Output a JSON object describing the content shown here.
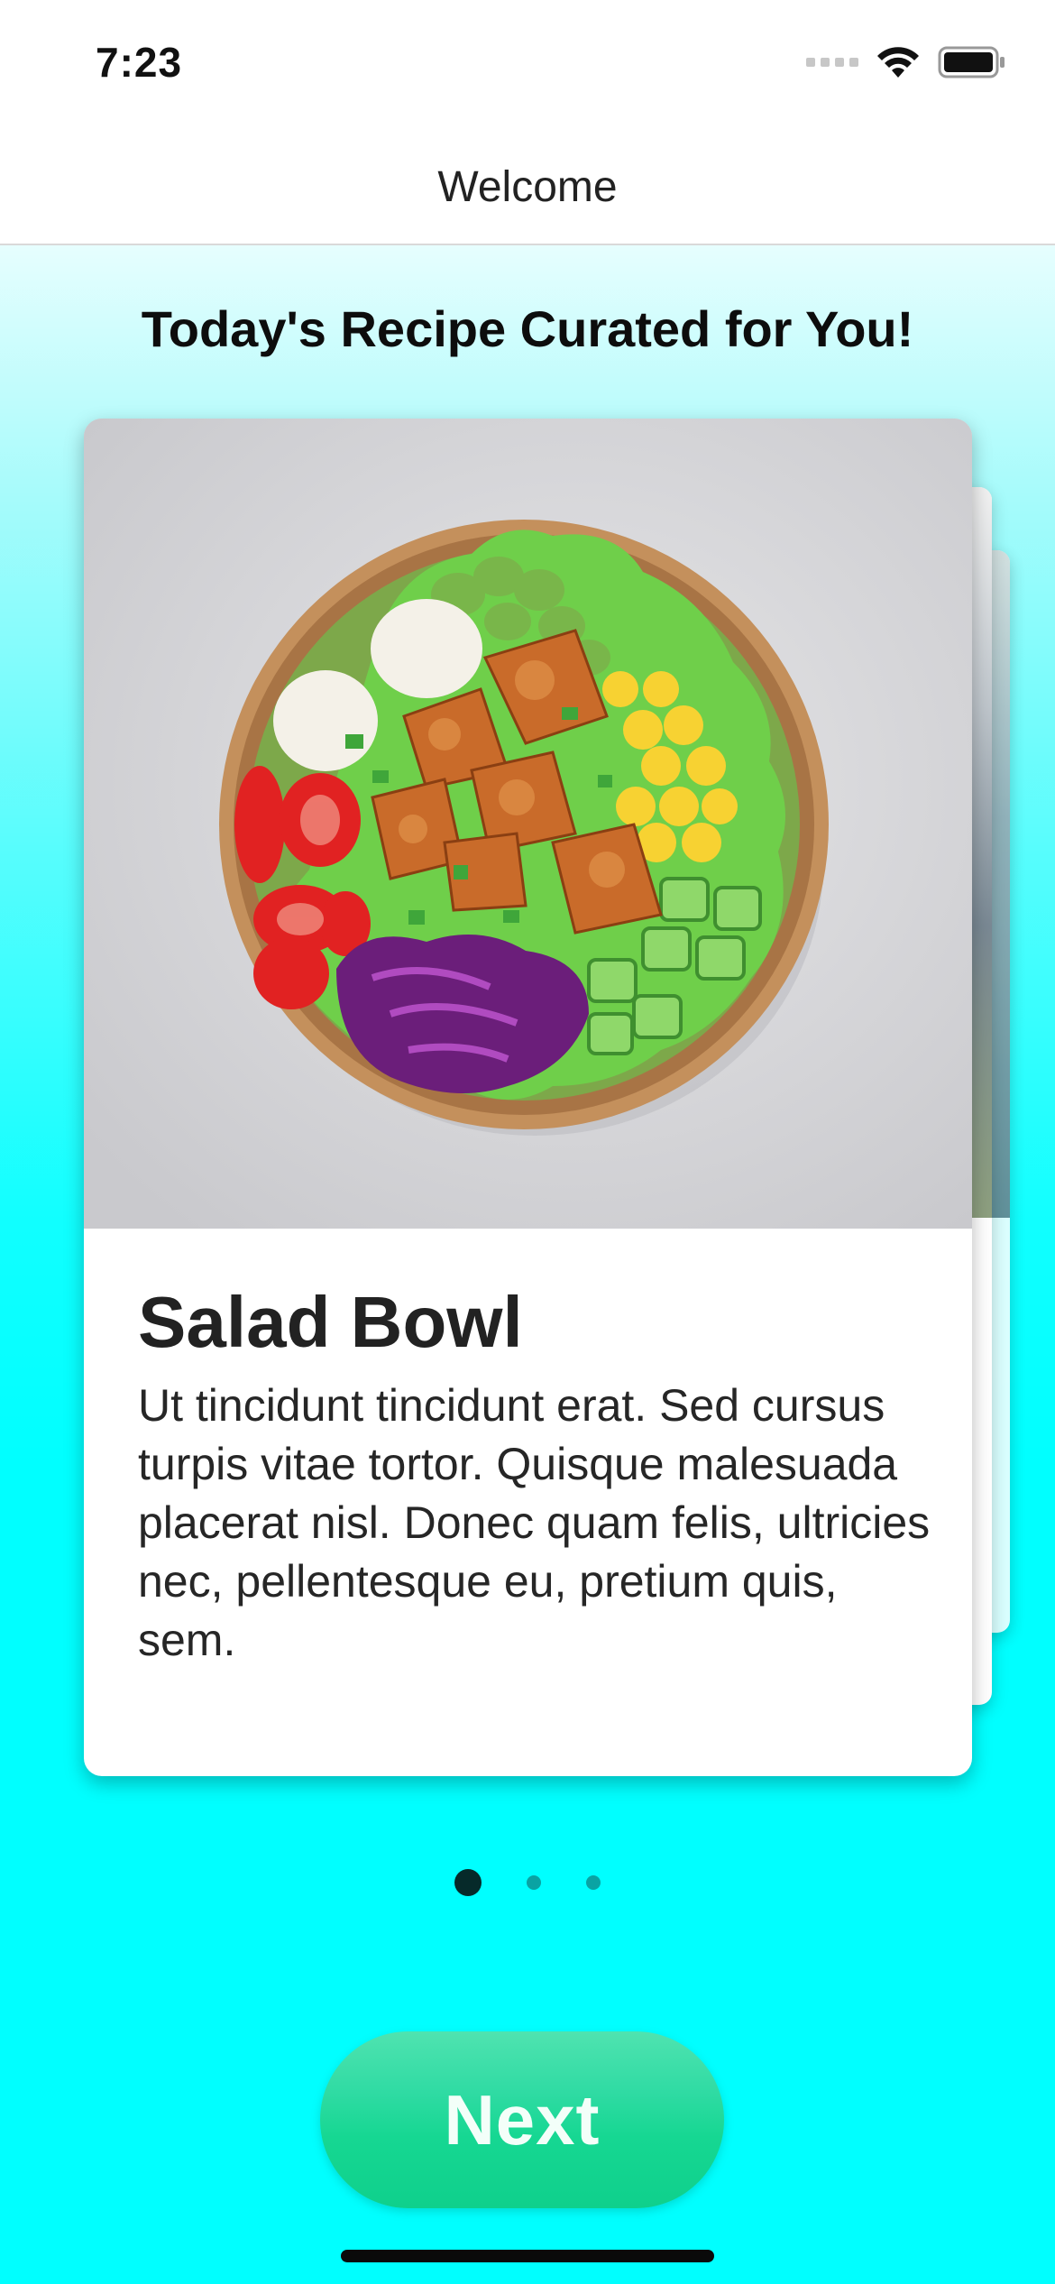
{
  "status": {
    "time": "7:23"
  },
  "nav": {
    "title": "Welcome"
  },
  "headline": "Today's Recipe Curated for You!",
  "card": {
    "title": "Salad Bowl",
    "description": "Ut tincidunt tincidunt erat. Sed cursus turpis vitae tortor. Quisque malesuada placerat nisl. Donec quam felis, ultricies nec, pellentesque eu, pretium quis, sem.",
    "image_icon": "salad-bowl-photo"
  },
  "pager": {
    "count": 3,
    "active_index": 0
  },
  "actions": {
    "next_label": "Next"
  },
  "colors": {
    "background": "#00ffff",
    "button": "#16d792",
    "pager_active": "#062a2a",
    "pager_inactive": "#0aa3a3"
  }
}
